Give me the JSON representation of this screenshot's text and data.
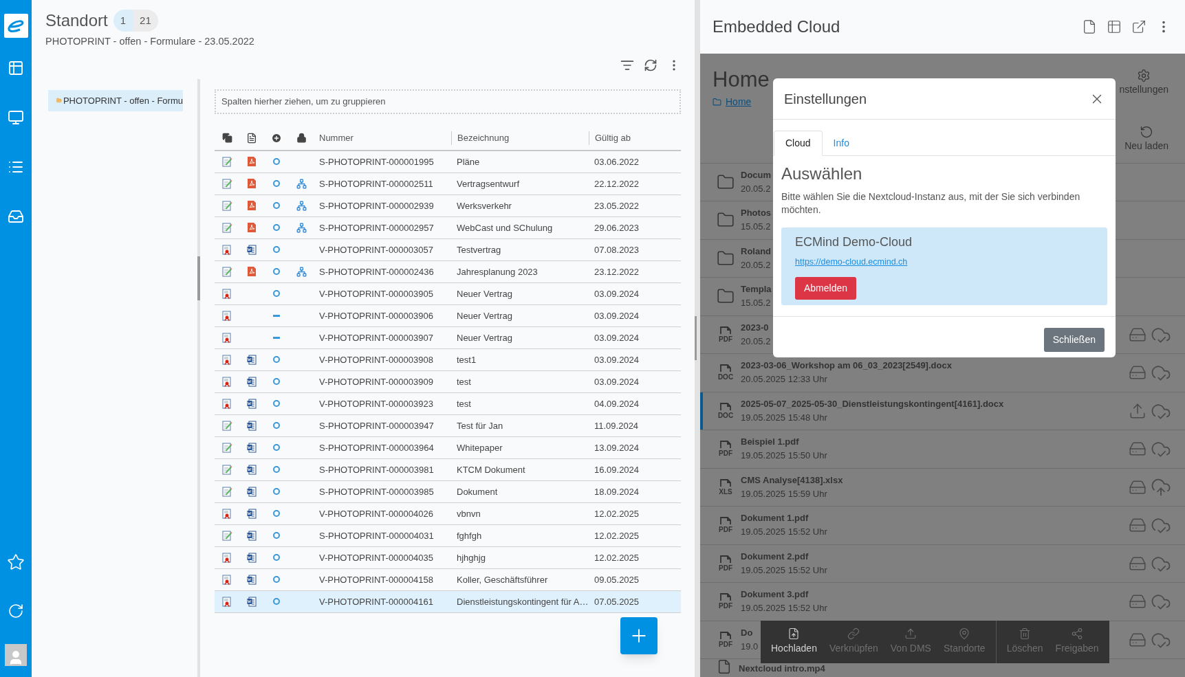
{
  "header": {
    "title": "Standort",
    "badges": [
      {
        "label": "1",
        "selected": true
      },
      {
        "label": "21",
        "selected": false
      }
    ],
    "subtitle": "PHOTOPRINT - offen - Formulare - 23.05.2022"
  },
  "tree": {
    "items": [
      {
        "label": "PHOTOPRINT - offen - Formu",
        "selected": true
      }
    ]
  },
  "group_panel": {
    "placeholder": "Spalten hierher ziehen, um zu gruppieren"
  },
  "table": {
    "columns": [
      "Nummer",
      "Bezeichnung",
      "Gültig ab"
    ],
    "rows": [
      {
        "kind": "form",
        "attachment": {
          "kind": "pdf"
        },
        "state": {
          "kind": "open"
        },
        "linked": false,
        "number": "S-PHOTOPRINT-000001995",
        "name": "Pläne",
        "valid_from": "03.06.2022",
        "selected": false
      },
      {
        "kind": "form",
        "attachment": {
          "kind": "pdf"
        },
        "state": {
          "kind": "open"
        },
        "linked": true,
        "number": "S-PHOTOPRINT-000002511",
        "name": "Vertragsentwurf",
        "valid_from": "22.12.2022",
        "selected": false
      },
      {
        "kind": "form",
        "attachment": {
          "kind": "pdf"
        },
        "state": {
          "kind": "open"
        },
        "linked": true,
        "number": "S-PHOTOPRINT-000002939",
        "name": "Werksverkehr",
        "valid_from": "23.05.2022",
        "selected": false
      },
      {
        "kind": "form",
        "attachment": {
          "kind": "pdf"
        },
        "state": {
          "kind": "open"
        },
        "linked": true,
        "number": "S-PHOTOPRINT-000002957",
        "name": "WebCast und SChulung",
        "valid_from": "29.06.2023",
        "selected": false
      },
      {
        "kind": "contract",
        "attachment": {
          "kind": "word"
        },
        "state": {
          "kind": "open"
        },
        "linked": false,
        "number": "V-PHOTOPRINT-000003057",
        "name": "Testvertrag",
        "valid_from": "07.08.2023",
        "selected": false
      },
      {
        "kind": "form",
        "attachment": {
          "kind": "pdf"
        },
        "state": {
          "kind": "open"
        },
        "linked": true,
        "number": "S-PHOTOPRINT-000002436",
        "name": "Jahresplanung 2023",
        "valid_from": "23.12.2022",
        "selected": false
      },
      {
        "kind": "contract",
        "state": {
          "kind": "open"
        },
        "linked": false,
        "number": "V-PHOTOPRINT-000003905",
        "name": "Neuer Vertrag",
        "valid_from": "03.09.2024",
        "selected": false
      },
      {
        "kind": "contract",
        "state": {
          "kind": "dash"
        },
        "linked": false,
        "number": "V-PHOTOPRINT-000003906",
        "name": "Neuer Vertrag",
        "valid_from": "03.09.2024",
        "selected": false
      },
      {
        "kind": "contract",
        "state": {
          "kind": "dash"
        },
        "linked": false,
        "number": "V-PHOTOPRINT-000003907",
        "name": "Neuer Vertrag",
        "valid_from": "03.09.2024",
        "selected": false
      },
      {
        "kind": "contract",
        "attachment": {
          "kind": "word"
        },
        "state": {
          "kind": "open"
        },
        "linked": false,
        "number": "V-PHOTOPRINT-000003908",
        "name": "test1",
        "valid_from": "03.09.2024",
        "selected": false
      },
      {
        "kind": "contract",
        "attachment": {
          "kind": "word"
        },
        "state": {
          "kind": "open"
        },
        "linked": false,
        "number": "V-PHOTOPRINT-000003909",
        "name": "test",
        "valid_from": "03.09.2024",
        "selected": false
      },
      {
        "kind": "contract",
        "attachment": {
          "kind": "word"
        },
        "state": {
          "kind": "open"
        },
        "linked": false,
        "number": "V-PHOTOPRINT-000003923",
        "name": "test",
        "valid_from": "04.09.2024",
        "selected": false
      },
      {
        "kind": "form",
        "attachment": {
          "kind": "word"
        },
        "state": {
          "kind": "open"
        },
        "linked": false,
        "number": "S-PHOTOPRINT-000003947",
        "name": "Test für Jan",
        "valid_from": "11.09.2024",
        "selected": false
      },
      {
        "kind": "form",
        "attachment": {
          "kind": "word"
        },
        "state": {
          "kind": "open"
        },
        "linked": false,
        "number": "S-PHOTOPRINT-000003964",
        "name": "Whitepaper",
        "valid_from": "13.09.2024",
        "selected": false
      },
      {
        "kind": "form",
        "attachment": {
          "kind": "word"
        },
        "state": {
          "kind": "open"
        },
        "linked": false,
        "number": "S-PHOTOPRINT-000003981",
        "name": "KTCM Dokument",
        "valid_from": "16.09.2024",
        "selected": false
      },
      {
        "kind": "form",
        "attachment": {
          "kind": "word"
        },
        "state": {
          "kind": "open"
        },
        "linked": false,
        "number": "S-PHOTOPRINT-000003985",
        "name": "Dokument",
        "valid_from": "18.09.2024",
        "selected": false
      },
      {
        "kind": "contract",
        "attachment": {
          "kind": "word"
        },
        "state": {
          "kind": "open"
        },
        "linked": false,
        "number": "V-PHOTOPRINT-000004026",
        "name": "vbnvn",
        "valid_from": "12.02.2025",
        "selected": false
      },
      {
        "kind": "form",
        "attachment": {
          "kind": "word"
        },
        "state": {
          "kind": "open"
        },
        "linked": false,
        "number": "S-PHOTOPRINT-000004031",
        "name": "fghfgh",
        "valid_from": "12.02.2025",
        "selected": false
      },
      {
        "kind": "contract",
        "attachment": {
          "kind": "word"
        },
        "state": {
          "kind": "open"
        },
        "linked": false,
        "number": "V-PHOTOPRINT-000004035",
        "name": "hjhghjg",
        "valid_from": "12.02.2025",
        "selected": false
      },
      {
        "kind": "contract",
        "attachment": {
          "kind": "word"
        },
        "state": {
          "kind": "open"
        },
        "linked": false,
        "number": "V-PHOTOPRINT-000004158",
        "name": "Koller, Geschäftsführer",
        "valid_from": "09.05.2025",
        "selected": false
      },
      {
        "kind": "contract",
        "attachment": {
          "kind": "word"
        },
        "state": {
          "kind": "open"
        },
        "linked": false,
        "number": "V-PHOTOPRINT-000004161",
        "name": "Dienstleistungskontingent für A…",
        "valid_from": "07.05.2025",
        "selected": true
      }
    ]
  },
  "cloud": {
    "title": "Embedded Cloud",
    "heading": "Home",
    "breadcrumb": "Home",
    "settings_label": "nstellungen",
    "reload_label": "Neu laden",
    "files": [
      {
        "kind": "folder",
        "name": "Docum",
        "date": "20.05.2",
        "selected": false
      },
      {
        "kind": "folder",
        "name": "Photos",
        "date": "15.05.2",
        "selected": false
      },
      {
        "kind": "folder",
        "name": "Roland",
        "date": "20.05.2",
        "selected": false
      },
      {
        "kind": "folder",
        "name": "Templa",
        "date": "15.05.2",
        "selected": false
      },
      {
        "kind": "file",
        "type_label": "PDF",
        "name": "2023-0",
        "date": "20.05.2",
        "local": {
          "kind": "drive"
        },
        "sync": {
          "kind": "check"
        },
        "selected": false
      },
      {
        "kind": "file",
        "type_label": "DOC",
        "name": "2023-03-06_Workshop am 06_03_2023[2549].docx",
        "date": "20.05.2025 12:33 Uhr",
        "local": {
          "kind": "drive"
        },
        "sync": {
          "kind": "check"
        },
        "selected": false
      },
      {
        "kind": "file",
        "type_label": "DOC",
        "name": "2025-05-07_2025-05-30_Dienstleistungskontingent[4161].docx",
        "date": "19.05.2025 15:48 Uhr",
        "local": {
          "kind": "upload"
        },
        "sync": {
          "kind": "check"
        },
        "selected": true
      },
      {
        "kind": "file",
        "type_label": "PDF",
        "name": "Beispiel 1.pdf",
        "date": "19.05.2025 15:50 Uhr",
        "local": {
          "kind": "drive"
        },
        "sync": {
          "kind": "check"
        },
        "selected": false
      },
      {
        "kind": "file",
        "type_label": "XLS",
        "name": "CMS Analyse[4138].xlsx",
        "date": "19.05.2025 15:59 Uhr",
        "local": {
          "kind": "drive"
        },
        "sync": {
          "kind": "upload"
        },
        "selected": false
      },
      {
        "kind": "file",
        "type_label": "PDF",
        "name": "Dokument 1.pdf",
        "date": "19.05.2025 15:52 Uhr",
        "local": {
          "kind": "drive"
        },
        "sync": {
          "kind": "check"
        },
        "selected": false
      },
      {
        "kind": "file",
        "type_label": "PDF",
        "name": "Dokument 2.pdf",
        "date": "19.05.2025 15:52 Uhr",
        "local": {
          "kind": "drive"
        },
        "sync": {
          "kind": "check"
        },
        "selected": false
      },
      {
        "kind": "file",
        "type_label": "PDF",
        "name": "Dokument 3.pdf",
        "date": "19.05.2025 15:52 Uhr",
        "local": {
          "kind": "drive"
        },
        "sync": {
          "kind": "check"
        },
        "selected": false
      },
      {
        "kind": "file",
        "type_label": "PDF",
        "name": "Do",
        "date": "19.0",
        "local": {
          "kind": "drive"
        },
        "sync": {
          "kind": "check"
        },
        "selected": false
      },
      {
        "kind": "partial",
        "name": "Nextcloud intro.mp4",
        "selected": false
      }
    ],
    "toolbar_groups": [
      [
        {
          "kind": "upload",
          "label": "Hochladen",
          "disabled": false
        },
        {
          "kind": "link",
          "label": "Verknüpfen",
          "disabled": true
        },
        {
          "kind": "dms",
          "label": "Von DMS",
          "disabled": true
        },
        {
          "kind": "location",
          "label": "Standorte",
          "disabled": true
        }
      ],
      [
        {
          "kind": "delete",
          "label": "Löschen",
          "disabled": true
        },
        {
          "kind": "share",
          "label": "Freigaben",
          "disabled": true
        }
      ]
    ]
  },
  "dialog": {
    "title": "Einstellungen",
    "tabs": [
      {
        "label": "Cloud",
        "selected": true
      },
      {
        "label": "Info",
        "selected": false
      }
    ],
    "heading": "Auswählen",
    "text": "Bitte wählen Sie die Nextcloud-Instanz aus, mit der Sie sich verbinden möchten.",
    "instance": {
      "name": "ECMind Demo-Cloud",
      "url": "https://demo-cloud.ecmind.ch",
      "button": "Abmelden"
    },
    "close_button": "Schließen"
  }
}
